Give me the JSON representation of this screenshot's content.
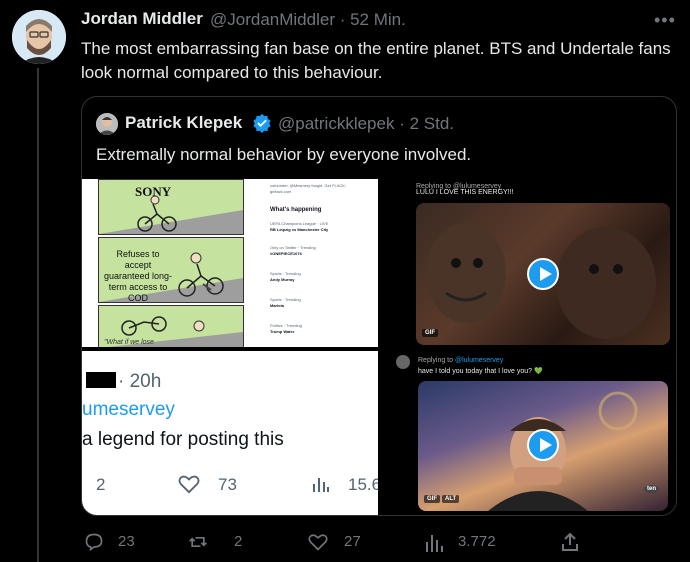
{
  "tweet": {
    "author_name": "Jordan Middler",
    "author_handle": "@JordanMiddler",
    "time": "· 52 Min.",
    "more_label": "•••",
    "text": "The most embarrassing fan base on the entire planet. BTS and Undertale fans look normal compared to this behaviour."
  },
  "quote": {
    "author_name": "Patrick Klepek",
    "author_handle": "@patrickklepek",
    "time": "· 2 Std.",
    "text": "Extremally normal behavior by everyone involved.",
    "media": {
      "meme_brand": "SONY",
      "meme_caption": "Refuses to accept guaranteed long-term access to COD",
      "meme_bottom": "\"What if we lose",
      "sidebar_header": "What's happening",
      "sidebar_items": [
        "UEFA Champions League · LIVE",
        "RB Leipzig vs Manchester City",
        "Only on Twitter · Trending",
        "#ONEPIECE1076",
        "Sports · Trending",
        "Andy Murray",
        "Sports · Trending",
        "Marieta",
        "Politics · Trending",
        "Trump Water"
      ],
      "sidebar_top": "cofounder. @Mesmery fangirl. Get FLACK: girflack.com",
      "top_right_reply": "Replying to @lulumeservey",
      "top_right_text": "LULU I LOVE THIS ENERGY!!!",
      "gif_label": "GIF",
      "alt_label": "ALT",
      "bottom_left_time": "· 20h",
      "bottom_left_handle": "umeservey",
      "bottom_left_text": "a legend for posting this",
      "bottom_left_actions": [
        "2",
        "73",
        "15.6"
      ],
      "bottom_right_reply_prefix": "Replying to ",
      "bottom_right_reply_handle": "@lulumeservey",
      "bottom_right_text": "have I told you today that I love you? 💚",
      "tv_logo": "ten"
    }
  },
  "actions": {
    "replies": "23",
    "retweets": "2",
    "likes": "27",
    "views": "3.772"
  }
}
